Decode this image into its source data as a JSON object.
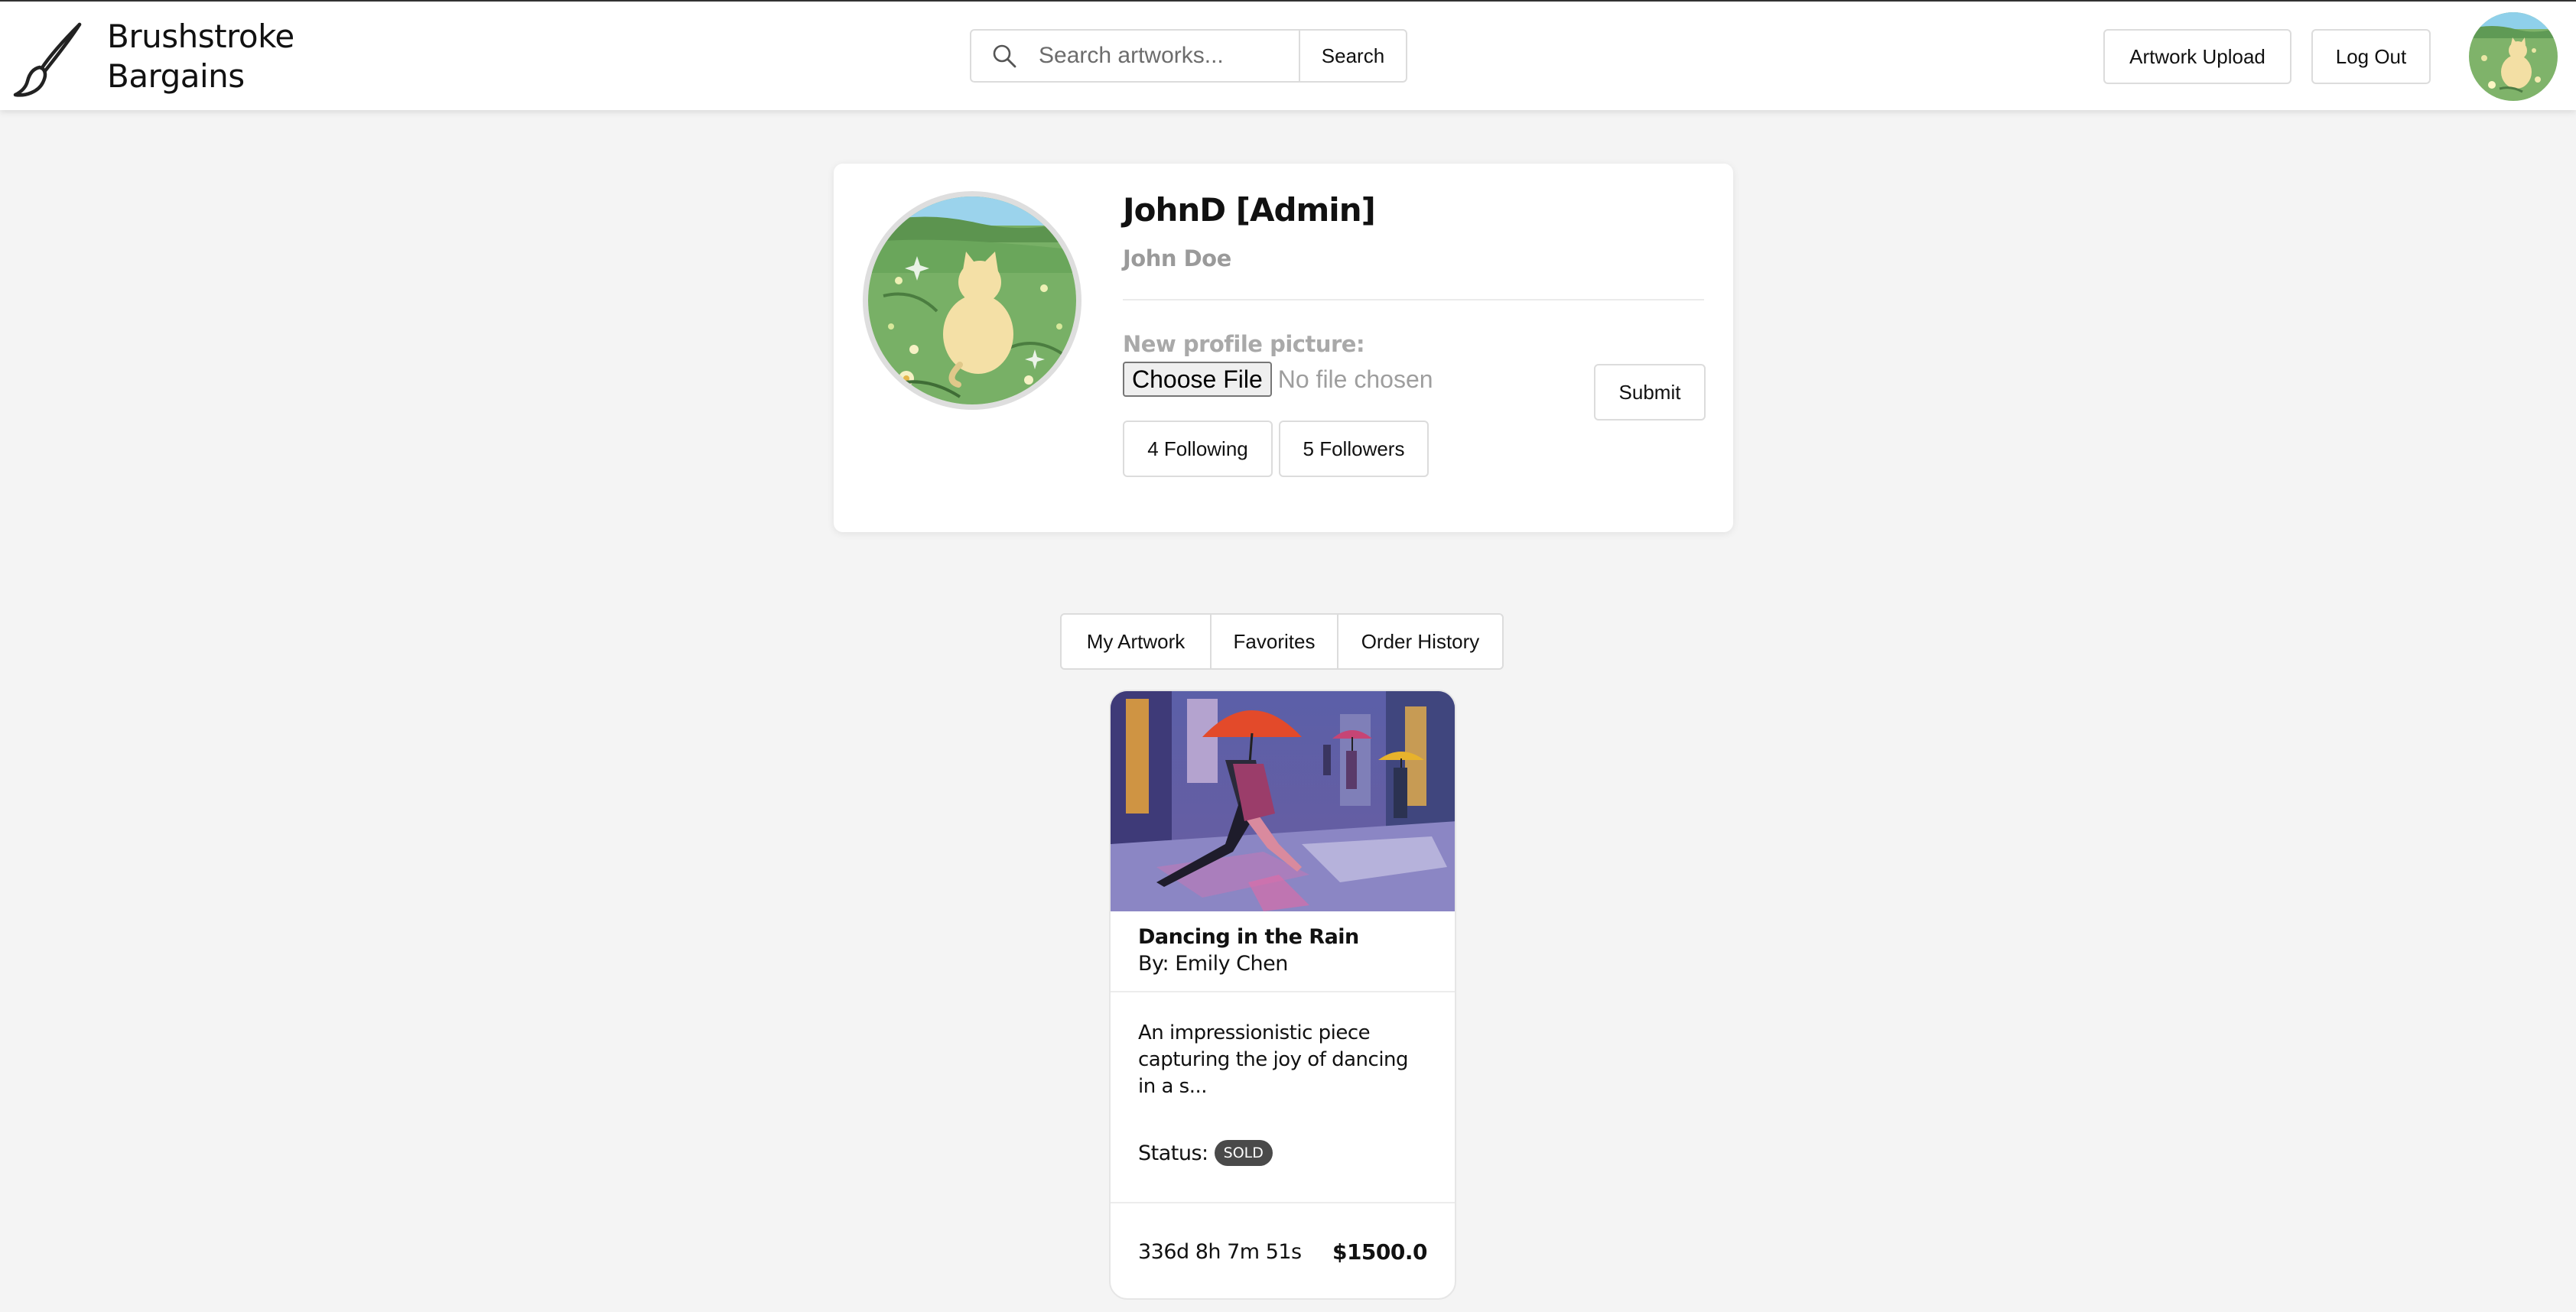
{
  "brand": {
    "line1": "Brushstroke",
    "line2": "Bargains",
    "icon": "paintbrush-icon"
  },
  "search": {
    "placeholder": "Search artworks...",
    "button_label": "Search",
    "icon": "search-icon"
  },
  "nav": {
    "upload_label": "Artwork Upload",
    "logout_label": "Log Out"
  },
  "profile": {
    "username": "JohnD [Admin]",
    "full_name": "John Doe",
    "new_picture_label": "New profile picture:",
    "choose_file_label": "Choose File",
    "no_file_text": "No file chosen",
    "submit_label": "Submit",
    "following_label": "4 Following",
    "followers_label": "5 Followers"
  },
  "tabs": [
    {
      "label": "My Artwork"
    },
    {
      "label": "Favorites"
    },
    {
      "label": "Order History"
    }
  ],
  "artworks": [
    {
      "title": "Dancing in the Rain",
      "artist": "By: Emily Chen",
      "description": "An impressionistic piece capturing the joy of dancing in a s...",
      "status_label": "Status:",
      "status": "SOLD",
      "time_left": "336d 8h 7m 51s",
      "price": "$1500.0"
    }
  ],
  "colors": {
    "badge": "#4a4a4a",
    "muted_text": "#9a9a9a",
    "background": "#f4f4f4"
  }
}
